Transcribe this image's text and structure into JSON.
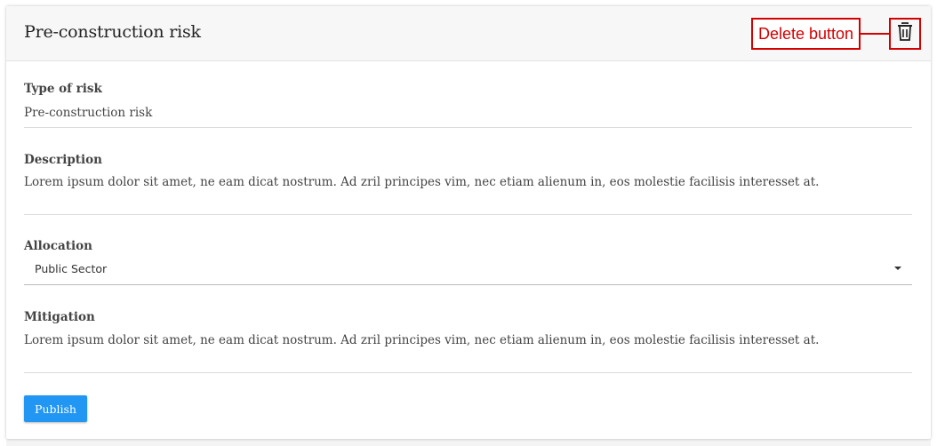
{
  "card": {
    "title": "Pre-construction risk"
  },
  "annotation": {
    "label": "Delete button"
  },
  "icons": {
    "delete": "trash-icon",
    "dropdown": "caret-down-icon"
  },
  "fields": {
    "type_of_risk": {
      "label": "Type of risk",
      "value": "Pre-construction risk"
    },
    "description": {
      "label": "Description",
      "value": "Lorem ipsum dolor sit amet, ne eam dicat nostrum. Ad zril principes vim, nec etiam alienum in, eos molestie facilisis interesset at."
    },
    "allocation": {
      "label": "Allocation",
      "selected": "Public Sector"
    },
    "mitigation": {
      "label": "Mitigation",
      "value": "Lorem ipsum dolor sit amet, ne eam dicat nostrum. Ad zril principes vim, nec etiam alienum in, eos molestie facilisis interesset at."
    }
  },
  "actions": {
    "publish_label": "Publish"
  },
  "colors": {
    "accent": "#2196f3",
    "annotation": "#d40000"
  }
}
